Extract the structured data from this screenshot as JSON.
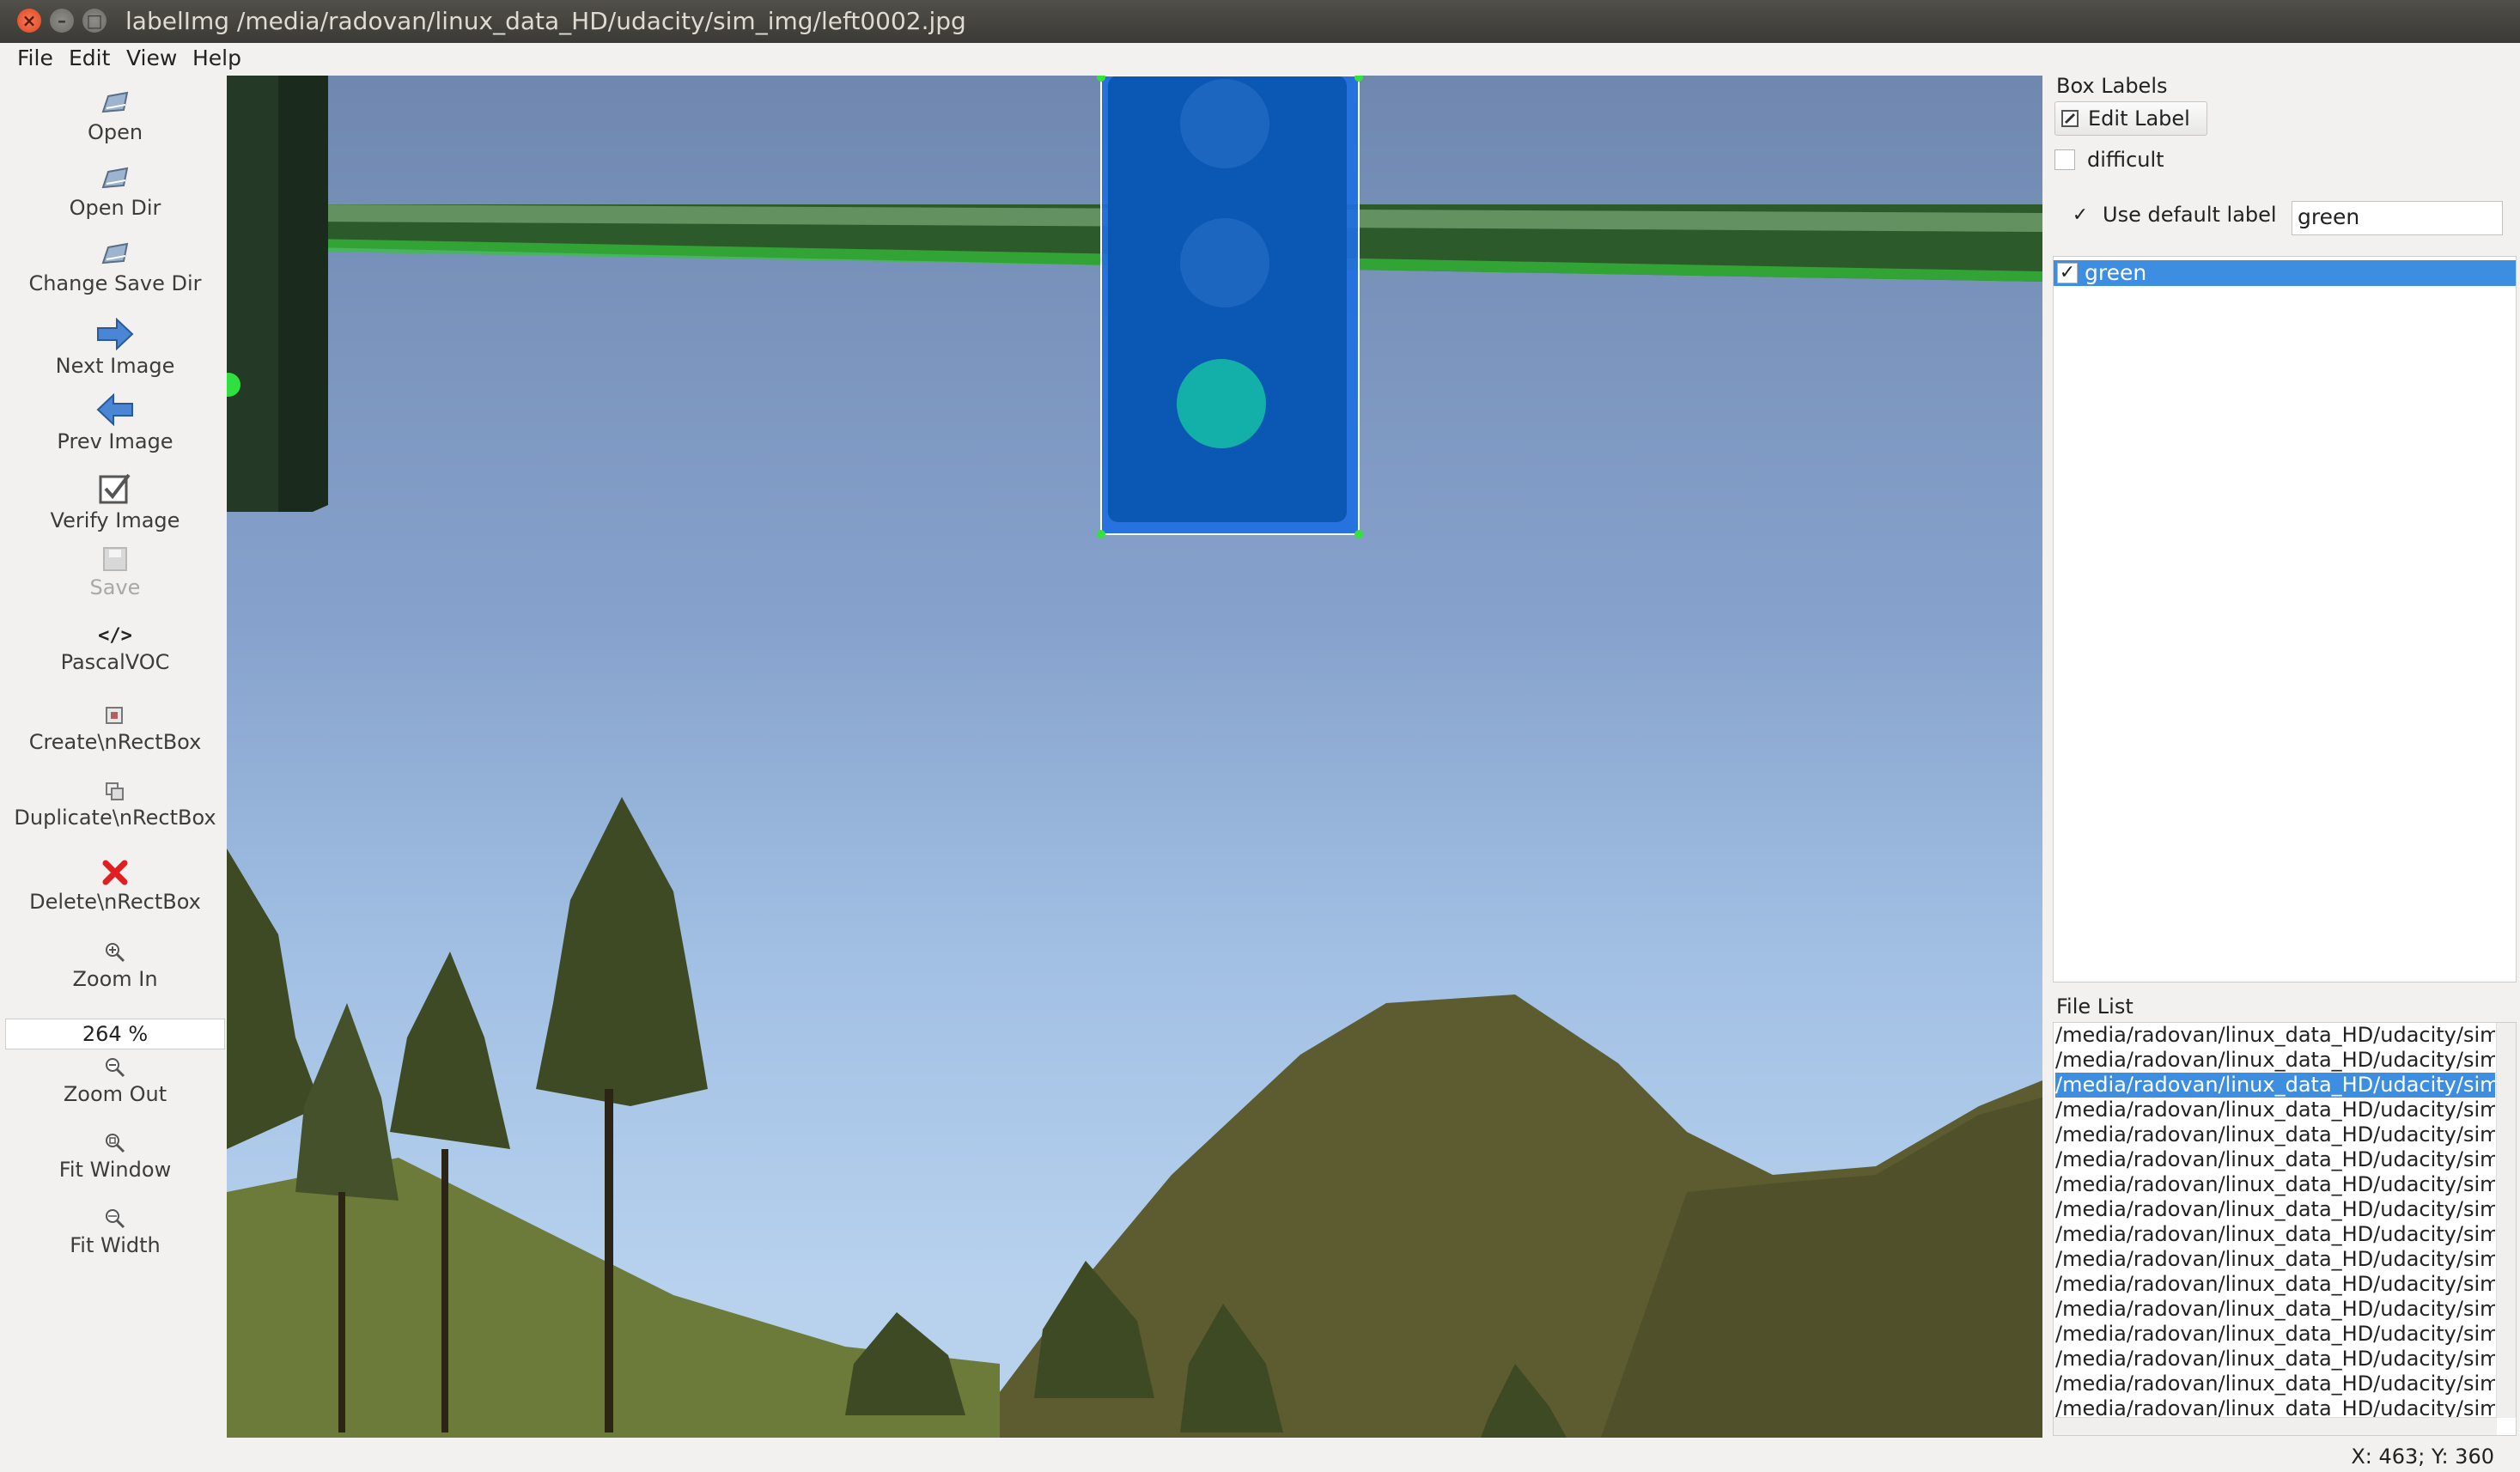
{
  "window": {
    "title": "labelImg /media/radovan/linux_data_HD/udacity/sim_img/left0002.jpg",
    "close_glyph": "×",
    "minimize_glyph": "–",
    "maximize_glyph": "□"
  },
  "menu": [
    "File",
    "Edit",
    "View",
    "Help"
  ],
  "toolbar": {
    "open": "Open",
    "open_dir": "Open Dir",
    "change_save_dir": "Change Save Dir",
    "next_image": "Next Image",
    "prev_image": "Prev Image",
    "verify_image": "Verify Image",
    "save": "Save",
    "format_icon_text": "</>",
    "format": "PascalVOC",
    "create_rect_box": "Create\\nRectBox",
    "duplicate_rect_box": "Duplicate\\nRectBox",
    "delete_rect_box": "Delete\\nRectBox",
    "zoom_in": "Zoom In",
    "zoom_value": "264 %",
    "zoom_out": "Zoom Out",
    "fit_window": "Fit Window",
    "fit_width": "Fit Width"
  },
  "box_labels": {
    "title": "Box Labels",
    "edit_label_button": "Edit Label",
    "difficult_label": "difficult",
    "difficult_checked": false,
    "use_default_label": "Use default label",
    "use_default_checked": true,
    "default_label_value": "green",
    "labels": [
      {
        "text": "green",
        "checked": true,
        "selected": true
      }
    ]
  },
  "file_list": {
    "title": "File List",
    "items": [
      "/media/radovan/linux_data_HD/udacity/sim",
      "/media/radovan/linux_data_HD/udacity/sim",
      "/media/radovan/linux_data_HD/udacity/sim",
      "/media/radovan/linux_data_HD/udacity/sim",
      "/media/radovan/linux_data_HD/udacity/sim",
      "/media/radovan/linux_data_HD/udacity/sim",
      "/media/radovan/linux_data_HD/udacity/sim",
      "/media/radovan/linux_data_HD/udacity/sim",
      "/media/radovan/linux_data_HD/udacity/sim",
      "/media/radovan/linux_data_HD/udacity/sim",
      "/media/radovan/linux_data_HD/udacity/sim",
      "/media/radovan/linux_data_HD/udacity/sim",
      "/media/radovan/linux_data_HD/udacity/sim",
      "/media/radovan/linux_data_HD/udacity/sim",
      "/media/radovan/linux_data_HD/udacity/sim",
      "/media/radovan/linux_data_HD/udacity/sim"
    ],
    "selected_index": 2
  },
  "status": {
    "coords": "X: 463; Y: 360"
  },
  "colors": {
    "selection": "#3d8ee0",
    "bbox_fill": "#1f6fe0",
    "bbox_handle": "#34e23a",
    "sky_top": "#7088b0",
    "sky_bottom": "#b8d2ee",
    "hill": "#5a5a30",
    "grass": "#6c7a3a",
    "trees": "#3e4a24"
  }
}
